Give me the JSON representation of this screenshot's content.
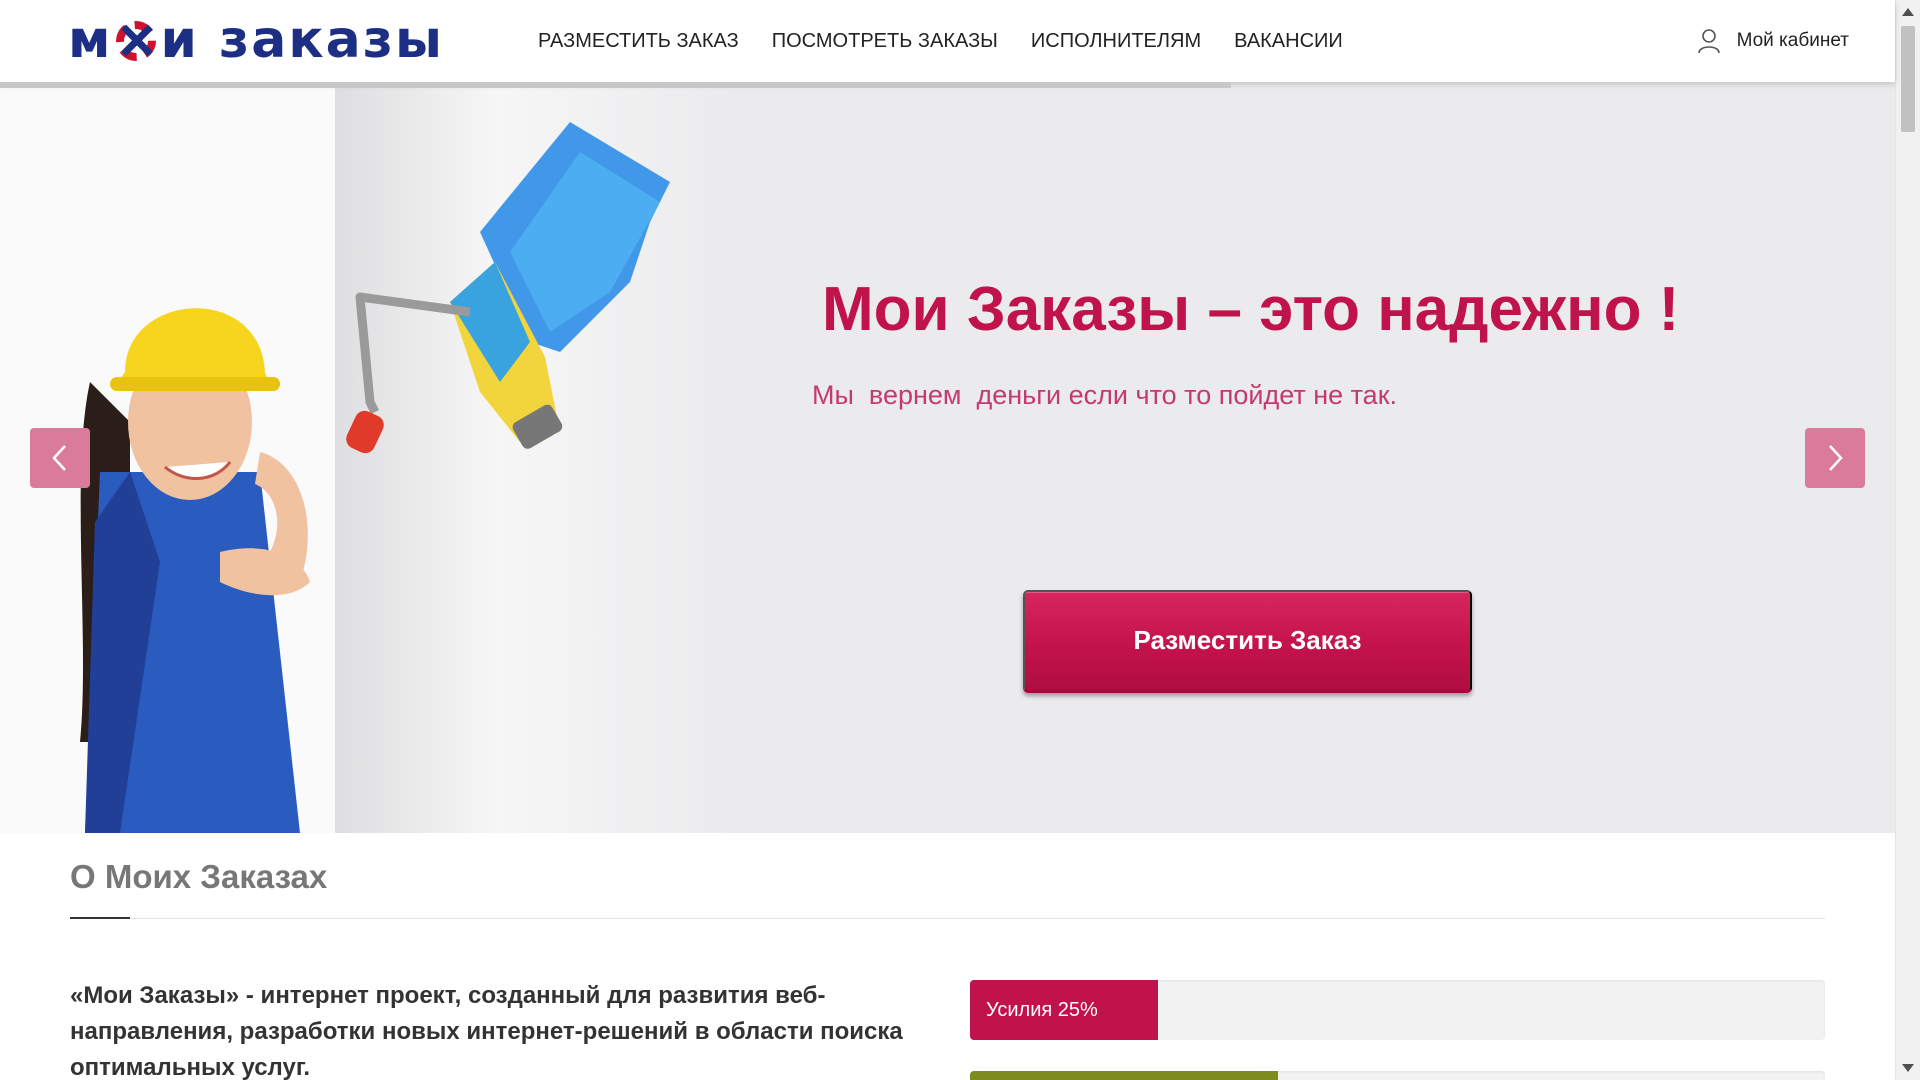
{
  "header": {
    "logo": {
      "part1": "м",
      "part2": "и заказы",
      "alt": "мои заказы"
    },
    "nav": [
      "РАЗМЕСТИТЬ ЗАКАЗ",
      "ПОСМОТРЕТЬ ЗАКАЗЫ",
      "ИСПОЛНИТЕЛЯМ",
      "ВАКАНСИИ"
    ],
    "cabinet_label": "Мой кабинет",
    "cabinet_icon": "user-icon"
  },
  "hero": {
    "title": "Мои Заказы – это надежно !",
    "subtitle": "Мы  вернем  деньги если что то пойдет не так.",
    "cta_label": "Разместить Заказ",
    "prev_icon": "chevron-left-icon",
    "next_icon": "chevron-right-icon"
  },
  "about": {
    "title": "О Моих Заказах",
    "text": "«Мои Заказы» - интернет проект, созданный для развития веб-направления, разработки новых интернет-решений в области поиска оптимальных услуг.",
    "bars": [
      {
        "label": "Усилия 25%",
        "percent": 22
      },
      {
        "label": "",
        "percent": 36
      }
    ]
  },
  "colors": {
    "brand_navy": "#1d2f85",
    "brand_red": "#c0124b",
    "arrow_pink": "#db7b9b",
    "bar_green": "#7c8c1d"
  }
}
